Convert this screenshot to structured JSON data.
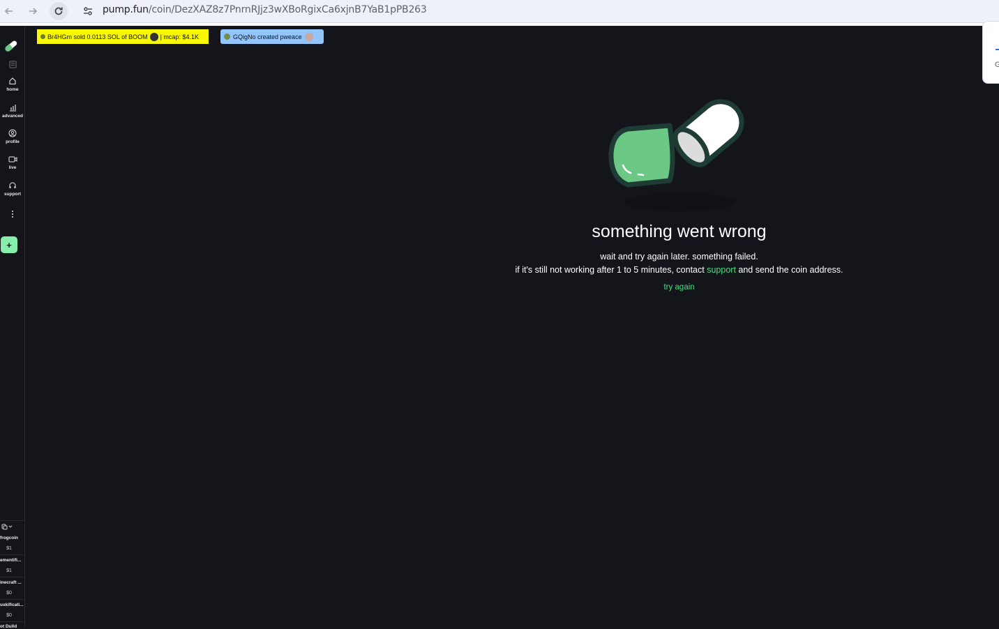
{
  "browser": {
    "url_domain": "pump.fun",
    "url_path": "/coin/DezXAZ8z7PnrnRJjz3wXBoRgixCa6xjnB7YaB1pPB263",
    "icons": [
      "back-arrow-icon",
      "forward-arrow-icon",
      "reload-icon",
      "site-info-icon"
    ],
    "popup_partial_text": "G"
  },
  "sidebar": {
    "items": [
      {
        "label": "",
        "icon": "board-icon"
      },
      {
        "label": "home",
        "icon": "home-icon"
      },
      {
        "label": "advanced",
        "icon": "chart-bars-icon"
      },
      {
        "label": "profile",
        "icon": "user-circle-icon"
      },
      {
        "label": "live",
        "icon": "video-camera-icon"
      },
      {
        "label": "support",
        "icon": "headset-icon"
      },
      {
        "label": "",
        "icon": "more-vertical-icon"
      }
    ],
    "create_label": "+",
    "watchlist": [
      {
        "name": "frogcoin",
        "price": "$1"
      },
      {
        "name": "ementifi...",
        "price": "$1"
      },
      {
        "name": "inecraft ...",
        "price": "$0"
      },
      {
        "name": "uskificati...",
        "price": "$0"
      },
      {
        "name": "ot Dulld",
        "price": ""
      }
    ]
  },
  "tickers": {
    "sell": {
      "user": "Br4HGm",
      "action": "sold 0.0113 SOL of BOOM",
      "mcap": "| mcap: $4.1K",
      "color": "#f8f800"
    },
    "create": {
      "user": "GQigNo",
      "action": "created pweace",
      "color": "#93c5fd"
    }
  },
  "error": {
    "title": "something went wrong",
    "line1": "wait and try again later. something failed.",
    "line2_before": "if it's still not working after 1 to 5 minutes, contact ",
    "line2_link": "support",
    "line2_after": " and send the coin address.",
    "retry": "try again"
  },
  "colors": {
    "accent": "#4ade80",
    "background": "#14151b",
    "pill_green": "#6bc985"
  }
}
